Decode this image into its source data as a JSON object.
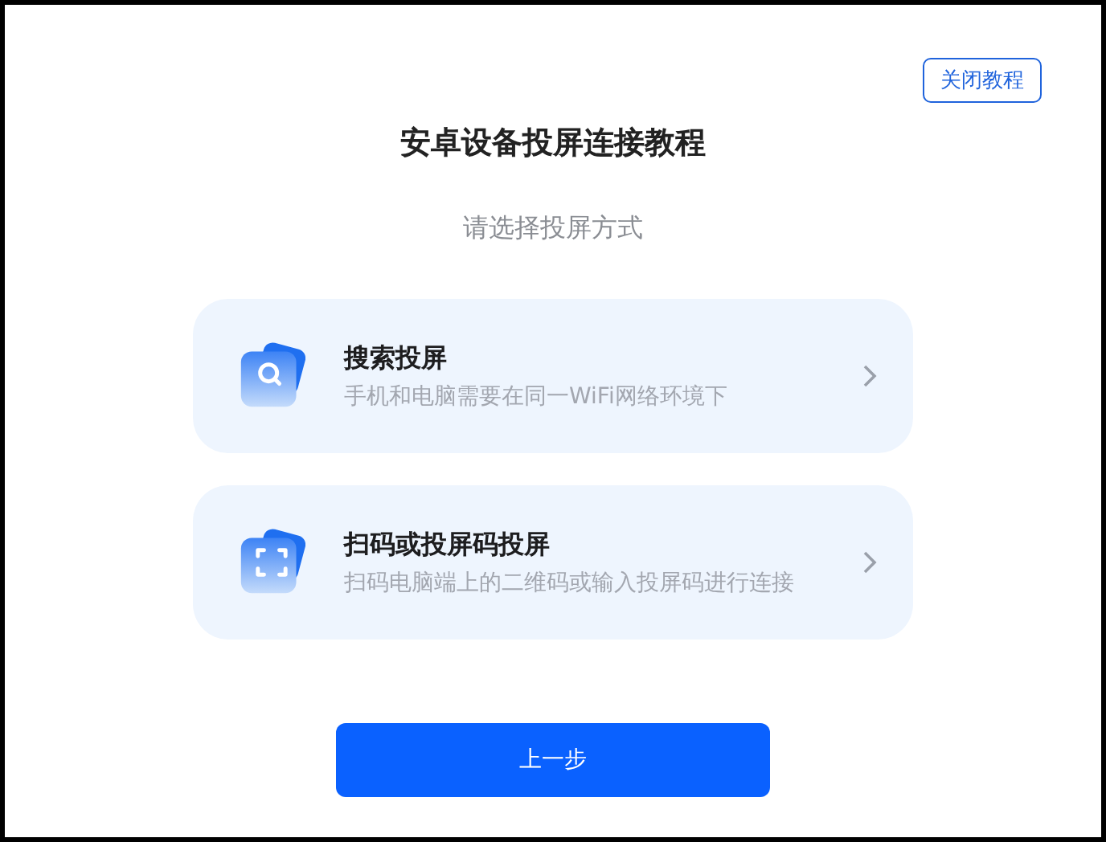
{
  "close_button": "关闭教程",
  "title": "安卓设备投屏连接教程",
  "subtitle": "请选择投屏方式",
  "options": [
    {
      "kind": "search",
      "title": "搜索投屏",
      "description": "手机和电脑需要在同一WiFi网络环境下"
    },
    {
      "kind": "scan",
      "title": "扫码或投屏码投屏",
      "description": "扫码电脑端上的二维码或输入投屏码进行连接"
    }
  ],
  "back_button": "上一步"
}
